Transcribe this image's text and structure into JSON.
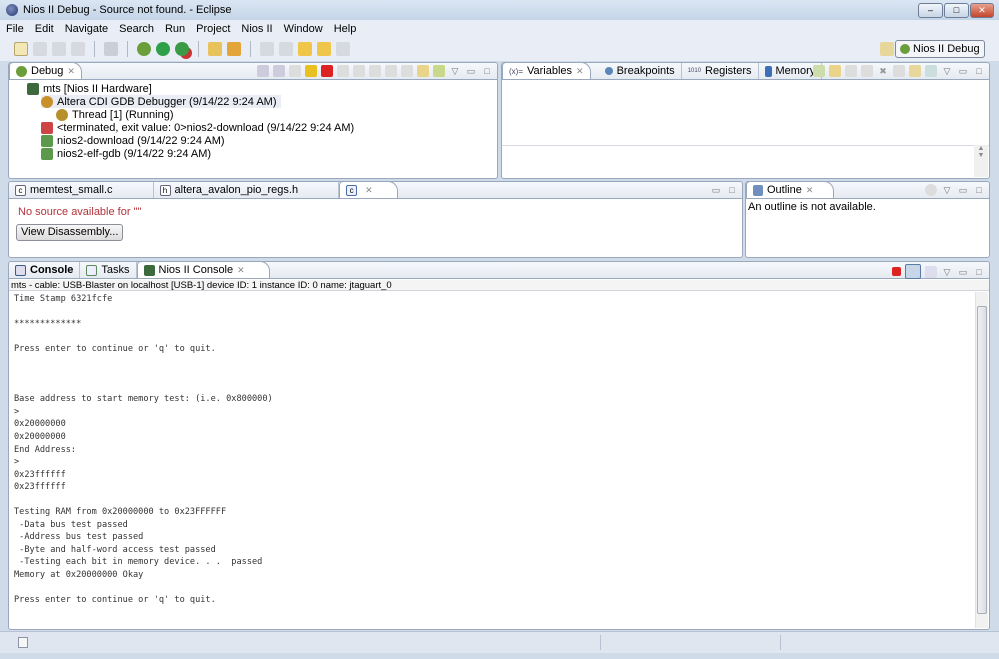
{
  "window": {
    "title": "Nios II Debug - Source not found. - Eclipse",
    "min": "–",
    "max": "□",
    "close": "✕"
  },
  "menu": [
    "File",
    "Edit",
    "Navigate",
    "Search",
    "Run",
    "Project",
    "Nios II",
    "Window",
    "Help"
  ],
  "perspective": {
    "label": "Nios II Debug"
  },
  "debug": {
    "tab": "Debug",
    "items": [
      "mts [Nios II Hardware]",
      "Altera CDI GDB Debugger (9/14/22 9:24 AM)",
      "Thread [1] (Running)",
      "<terminated, exit value: 0>nios2-download (9/14/22 9:24 AM)",
      "nios2-download (9/14/22 9:24 AM)",
      "nios2-elf-gdb (9/14/22 9:24 AM)"
    ]
  },
  "vars": {
    "tabs": [
      "Variables",
      "Breakpoints",
      "Registers",
      "Memory"
    ]
  },
  "editor": {
    "tabs": [
      "memtest_small.c",
      "altera_avalon_pio_regs.h",
      ""
    ],
    "message": "No source available for \"\"",
    "button": "View Disassembly..."
  },
  "outline": {
    "tab": "Outline",
    "message": "An outline is not available."
  },
  "console": {
    "tabs": [
      "Console",
      "Tasks",
      "Nios II Console"
    ],
    "header": "mts - cable: USB-Blaster on localhost [USB-1] device ID: 1 instance ID: 0 name: jtaguart_0",
    "output": "Time Stamp 6321fcfe\n\n*************\n\nPress enter to continue or 'q' to quit.\n\n\n\nBase address to start memory test: (i.e. 0x800000)\n>\n0x20000000\n0x20000000\nEnd Address:\n>\n0x23ffffff\n0x23ffffff\n\nTesting RAM from 0x20000000 to 0x23FFFFFF\n -Data bus test passed\n -Address bus test passed\n -Byte and half-word access test passed\n -Testing each bit in memory device. . .  passed\nMemory at 0x20000000 Okay\n\nPress enter to continue or 'q' to quit."
  }
}
